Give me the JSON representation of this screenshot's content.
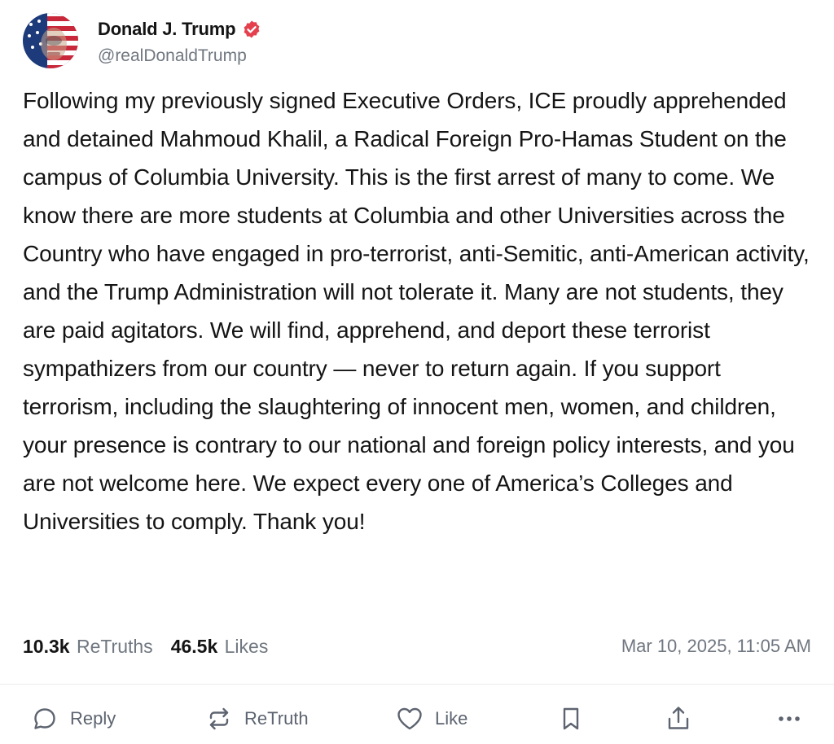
{
  "author": {
    "display_name": "Donald J. Trump",
    "handle": "@realDonaldTrump",
    "verified_color": "#e5404d",
    "avatar_icon": "avatar-photo"
  },
  "post": {
    "text": "Following my previously signed Executive Orders, ICE proudly apprehended and detained Mahmoud Khalil, a Radical Foreign Pro-Hamas Student on the campus of Columbia University. This is the first arrest of many to come. We know there are more students at Columbia and other Universities across the Country who have engaged in pro-terrorist, anti-Semitic, anti-American activity, and the Trump Administration will not tolerate it. Many are not students, they are paid agitators. We will find, apprehend, and deport these terrorist sympathizers from our country — never to return again. If you support terrorism, including the slaughtering of innocent men, women, and children, your presence is contrary to our national and foreign policy interests, and you are not welcome here. We expect every one of America’s Colleges and Universities to comply. Thank you!"
  },
  "stats": {
    "retruths_count": "10.3k",
    "retruths_label": "ReTruths",
    "likes_count": "46.5k",
    "likes_label": "Likes",
    "timestamp": "Mar 10, 2025, 11:05 AM"
  },
  "actions": {
    "reply_label": "Reply",
    "retruth_label": "ReTruth",
    "like_label": "Like"
  },
  "colors": {
    "text": "#141414",
    "muted": "#707780",
    "action": "#5d6470",
    "divider": "#ececef"
  }
}
